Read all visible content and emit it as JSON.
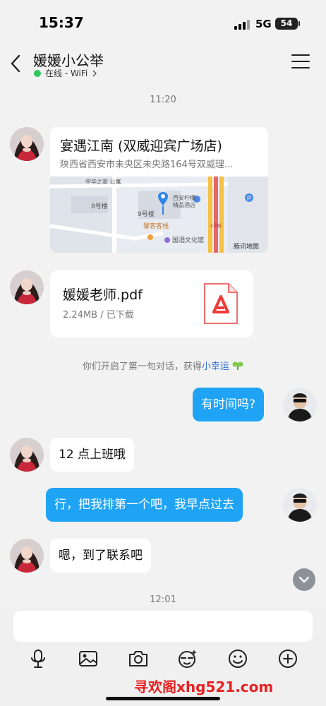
{
  "status_bar": {
    "time": "15:37",
    "network": "5G",
    "battery": "54"
  },
  "header": {
    "title": "媛媛小公举",
    "presence": "在线 - WiFi"
  },
  "messages": {
    "time_1": "11:20",
    "location": {
      "name": "宴遇江南 (双威迎宾广场店)",
      "address": "陕西省西安市未央区未央路164号双威理...",
      "map_labels": [
        "中华之家·公寓",
        "8号楼",
        "9号楼",
        "西安柠檬",
        "精品酒店",
        "馨客客栈",
        "国酒文化馆",
        "2号线",
        "腾讯地图"
      ]
    },
    "file": {
      "name": "媛媛老师.pdf",
      "meta": "2.24MB / 已下载"
    },
    "system_note": "你们开启了第一句对话，获得",
    "system_highlight": "小幸运",
    "out_1": "有时间吗?",
    "in_1": "12 点上班哦",
    "out_2": "行，把我排第一个吧，我早点过去",
    "in_2": "嗯，到了联系吧",
    "time_2": "12:01"
  },
  "composer": {
    "placeholder": "",
    "toolbar": [
      "microphone-icon",
      "image-icon",
      "camera-icon",
      "sticker-icon",
      "emoji-icon",
      "plus-icon"
    ]
  },
  "watermark": "寻欢阁xhg521.com",
  "colors": {
    "outgoing": "#1fa3f5",
    "incoming": "#ffffff",
    "online": "#2bc860",
    "highlight": "#2a6ed6",
    "watermark": "#e82121"
  }
}
